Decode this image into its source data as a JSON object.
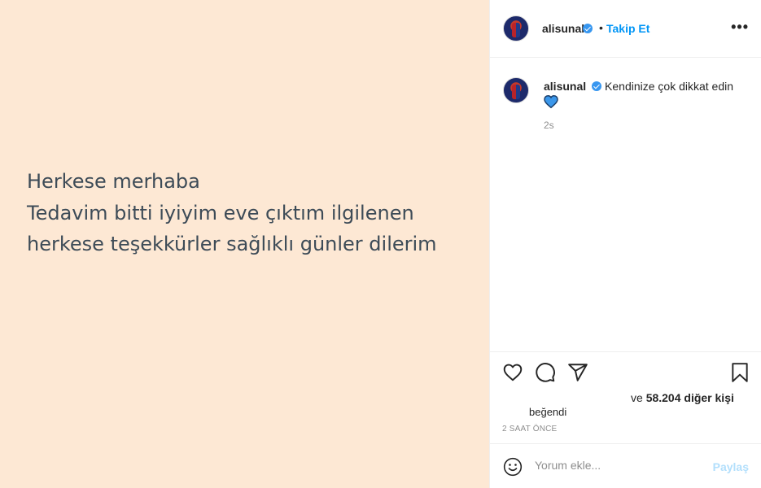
{
  "post": {
    "lines": [
      "Herkese merhaba",
      "Tedavim bitti iyiyim eve çıktım ilgilenen",
      "herkese teşekkürler sağlıklı günler dilerim"
    ]
  },
  "header": {
    "username": "alisunal",
    "separator": "•",
    "follow_label": "Takip Et",
    "more_label": "•••"
  },
  "caption": {
    "username": "alisunal",
    "text": "Kendinize çok dikkat edin",
    "emoji": "blue-heart",
    "time": "2s"
  },
  "actions": {
    "icons": [
      "heart-icon",
      "comment-icon",
      "share-icon",
      "bookmark-icon"
    ],
    "liked_by_label": "beğendi",
    "others_prefix": "ve",
    "others_count": "58.204 diğer kişi",
    "posted_ago": "2 SAAT ÖNCE"
  },
  "comment_bar": {
    "placeholder": "Yorum ekle...",
    "share_label": "Paylaş"
  },
  "colors": {
    "post_background": "#fde8d4",
    "post_text": "#3d4b57",
    "accent": "#0095f6",
    "share_disabled": "#b2dffc",
    "verified": "#3897f0"
  }
}
